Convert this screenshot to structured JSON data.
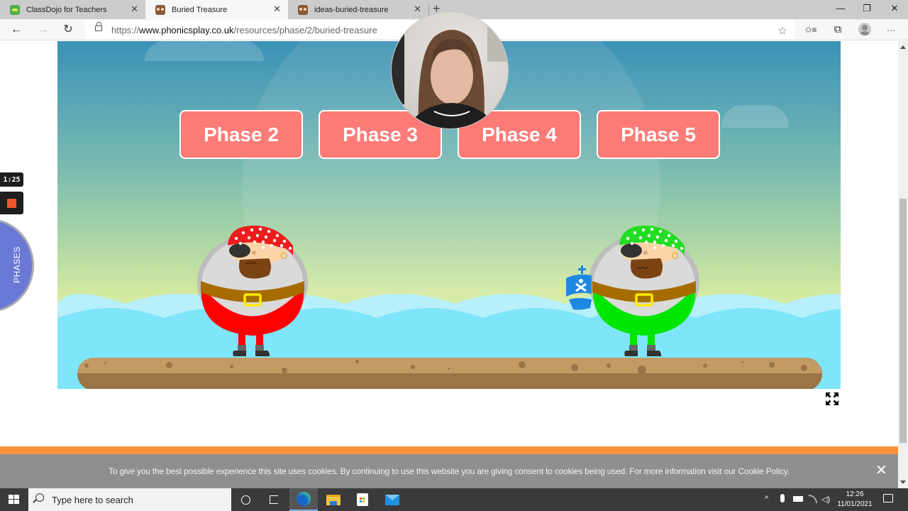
{
  "browser": {
    "tabs": [
      {
        "title": "ClassDojo for Teachers",
        "icon": "classdojo-favicon",
        "active": false
      },
      {
        "title": "Buried Treasure",
        "icon": "phonicsplay-favicon",
        "active": true
      },
      {
        "title": "ideas-buried-treasure",
        "icon": "phonicsplay-favicon",
        "active": false
      }
    ],
    "new_tab_label": "+",
    "window_controls": {
      "minimize": "—",
      "maximize": "❐",
      "close": "✕"
    },
    "address": {
      "protocol": "https://",
      "host": "www.phonicsplay.co.uk",
      "path": "/resources/phase/2/buried-treasure"
    },
    "toolbar_icons": [
      "back-icon",
      "forward-icon",
      "refresh-icon",
      "lock-icon",
      "favorite-star-icon",
      "favorites-list-icon",
      "collections-icon",
      "profile-icon",
      "more-icon"
    ],
    "glyphs": {
      "back": "←",
      "forward": "→",
      "refresh": "↻",
      "star": "☆",
      "favorites": "✩≡",
      "collections": "⧉",
      "more": "···",
      "tab_close": "✕"
    }
  },
  "game": {
    "title": "Buried Treasure",
    "phase_buttons": [
      {
        "label": "Phase 2"
      },
      {
        "label": "Phase 3"
      },
      {
        "label": "Phase 4"
      },
      {
        "label": "Phase 5"
      }
    ],
    "colors": {
      "button": "#fd7b76",
      "pirate_left": "#ff0000",
      "pirate_right": "#00e000",
      "sea": "#00e1fb",
      "raft": "#c19a64",
      "flag": "#1e88e5"
    },
    "fullscreen_icon": "expand-arrows-icon"
  },
  "overlays": {
    "timer": "1:25",
    "record_icon": "stop-record-icon",
    "phases_tab": "PHASES",
    "webcam": "presenter-webcam"
  },
  "cookie_banner": {
    "text": "To give you the best possible experience this site uses cookies. By continuing to use this website you are giving consent to cookies being used. For more information visit our Cookie Policy.",
    "close": "✕"
  },
  "taskbar": {
    "search_placeholder": "Type here to search",
    "apps": [
      "cortana-icon",
      "task-view-icon",
      "edge-icon",
      "file-explorer-icon",
      "store-icon",
      "mail-icon"
    ],
    "tray_icons": [
      "show-hidden-icon",
      "microphone-icon",
      "battery-icon",
      "wifi-icon",
      "volume-icon"
    ],
    "time": "12:26",
    "date": "11/01/2021",
    "tray_glyphs": {
      "chevron": "^",
      "volume": "🔈"
    }
  }
}
